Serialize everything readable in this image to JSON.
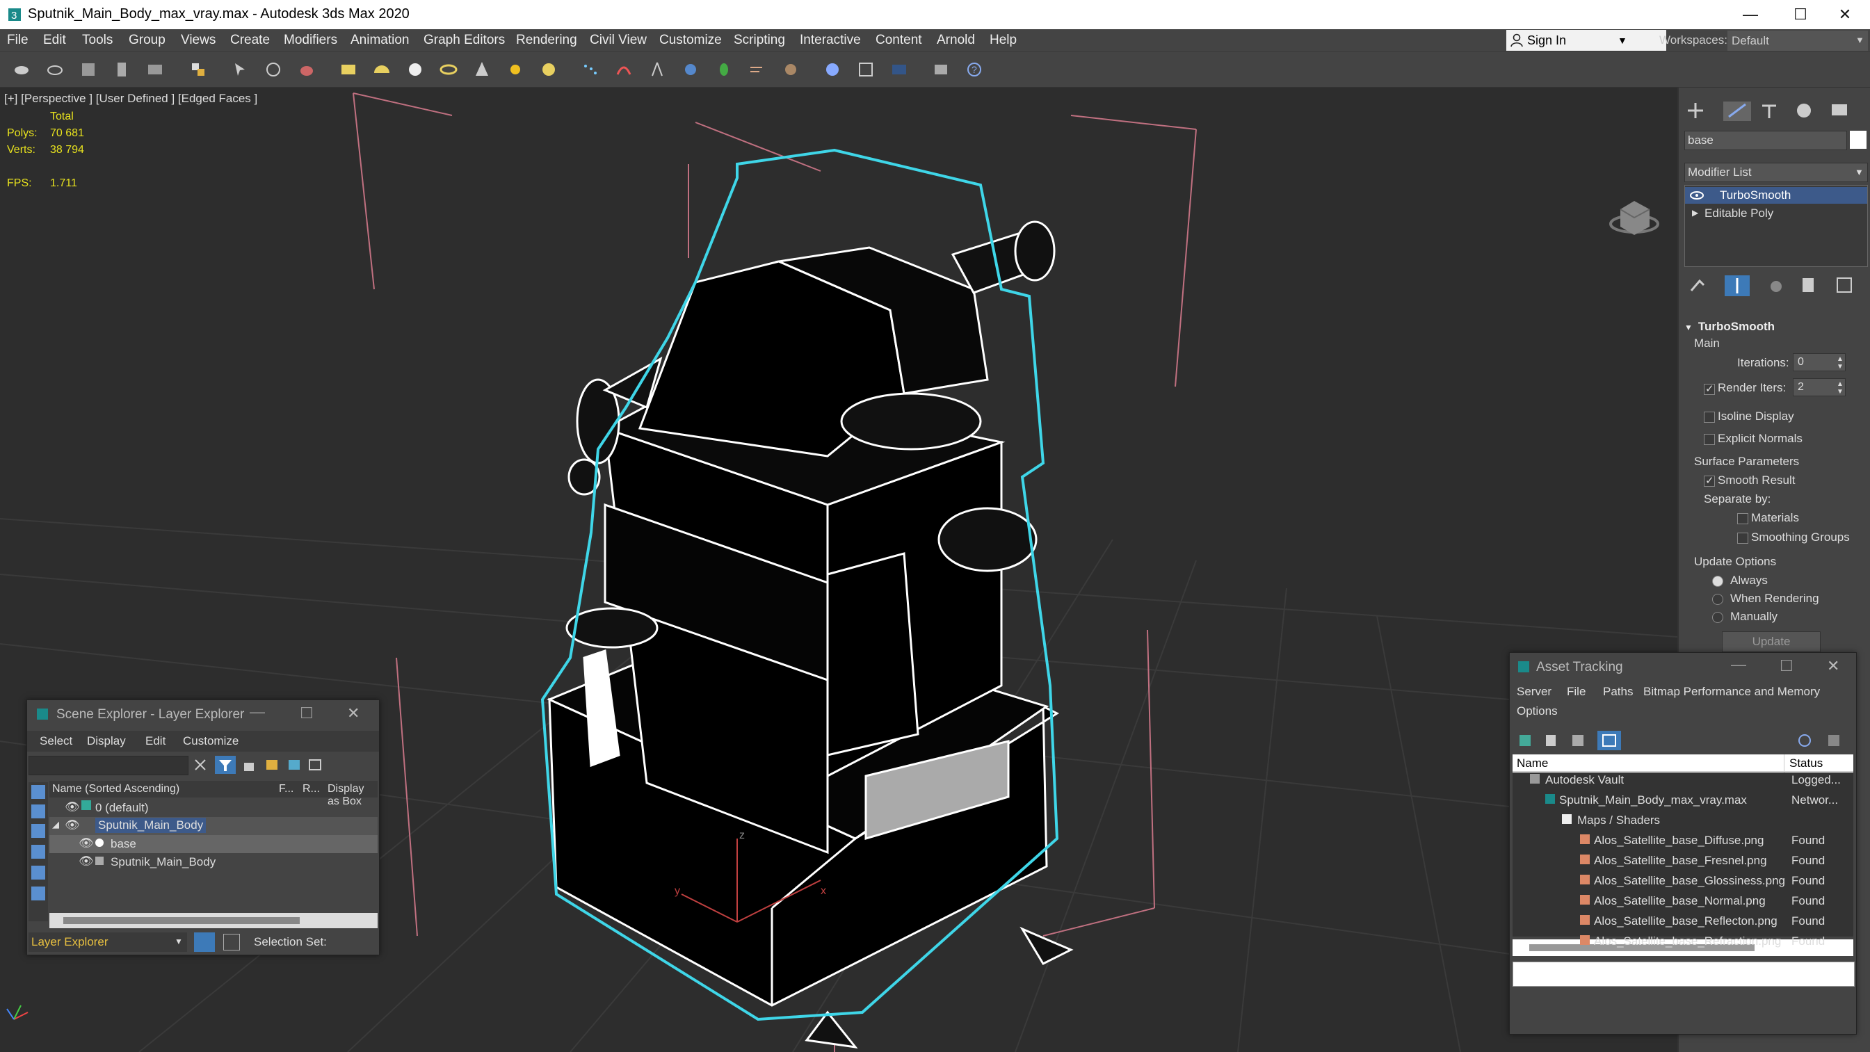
{
  "window": {
    "title": "Sputnik_Main_Body_max_vray.max - Autodesk 3ds Max 2020",
    "minimize": "—",
    "maximize": "☐",
    "close": "✕"
  },
  "menu": [
    "File",
    "Edit",
    "Tools",
    "Group",
    "Views",
    "Create",
    "Modifiers",
    "Animation",
    "Graph Editors",
    "Rendering",
    "Civil View",
    "Customize",
    "Scripting",
    "Interactive",
    "Content",
    "Arnold",
    "Help"
  ],
  "signin": {
    "label": "Sign In",
    "arrow": "▼"
  },
  "workspace": {
    "label": "Workspaces:",
    "value": "Default"
  },
  "viewport": {
    "label": "[+] [Perspective ] [User Defined ] [Edged Faces ]",
    "stats": {
      "total_label": "Total",
      "polys_label": "Polys:",
      "polys_value": "70 681",
      "verts_label": "Verts:",
      "verts_value": "38 794",
      "fps_label": "FPS:",
      "fps_value": "1.711"
    },
    "axis_x": "x",
    "axis_y": "y",
    "axis_z": "z"
  },
  "command_panel": {
    "object_name": "base",
    "modifier_list": "Modifier List",
    "stack": [
      {
        "label": "TurboSmooth",
        "selected": true
      },
      {
        "label": "Editable Poly",
        "selected": false
      }
    ],
    "rollout_title": "TurboSmooth",
    "main_label": "Main",
    "iterations_label": "Iterations:",
    "iterations_value": "0",
    "render_iters_label": "Render Iters:",
    "render_iters_value": "2",
    "isoline_label": "Isoline Display",
    "explicit_normals_label": "Explicit Normals",
    "surface_params_label": "Surface Parameters",
    "smooth_result_label": "Smooth Result",
    "separate_by_label": "Separate by:",
    "materials_label": "Materials",
    "smoothing_groups_label": "Smoothing Groups",
    "update_options_label": "Update Options",
    "always_label": "Always",
    "when_rendering_label": "When Rendering",
    "manually_label": "Manually",
    "update_button": "Update"
  },
  "scene_explorer": {
    "title": "Scene Explorer - Layer Explorer",
    "menu": [
      "Select",
      "Display",
      "Edit",
      "Customize"
    ],
    "columns": {
      "name": "Name (Sorted Ascending)",
      "f": "F...",
      "r": "R...",
      "box": "Display as Box"
    },
    "rows": [
      {
        "label": "0 (default)"
      },
      {
        "label": "Sputnik_Main_Body"
      },
      {
        "label": "base"
      },
      {
        "label": "Sputnik_Main_Body"
      }
    ],
    "footer_combo": "Layer Explorer",
    "selection_set": "Selection Set:"
  },
  "asset_tracking": {
    "title": "Asset Tracking",
    "menu": [
      "Server",
      "File",
      "Paths",
      "Bitmap Performance and Memory",
      "Options"
    ],
    "columns": {
      "name": "Name",
      "status": "Status"
    },
    "rows": [
      {
        "name": "Autodesk Vault",
        "status": "Logged..."
      },
      {
        "name": "Sputnik_Main_Body_max_vray.max",
        "status": "Networ..."
      },
      {
        "name": "Maps / Shaders",
        "status": ""
      },
      {
        "name": "Alos_Satellite_base_Diffuse.png",
        "status": "Found"
      },
      {
        "name": "Alos_Satellite_base_Fresnel.png",
        "status": "Found"
      },
      {
        "name": "Alos_Satellite_base_Glossiness.png",
        "status": "Found"
      },
      {
        "name": "Alos_Satellite_base_Normal.png",
        "status": "Found"
      },
      {
        "name": "Alos_Satellite_base_Reflecton.png",
        "status": "Found"
      },
      {
        "name": "Alos_Satellite_base_Refraction.png",
        "status": "Found"
      }
    ]
  },
  "colors": {
    "accent_blue": "#3d5a8a",
    "selection_cyan": "#3fd6e8",
    "stat_yellow": "#e8e21e",
    "grid": "#3b3b3b"
  }
}
